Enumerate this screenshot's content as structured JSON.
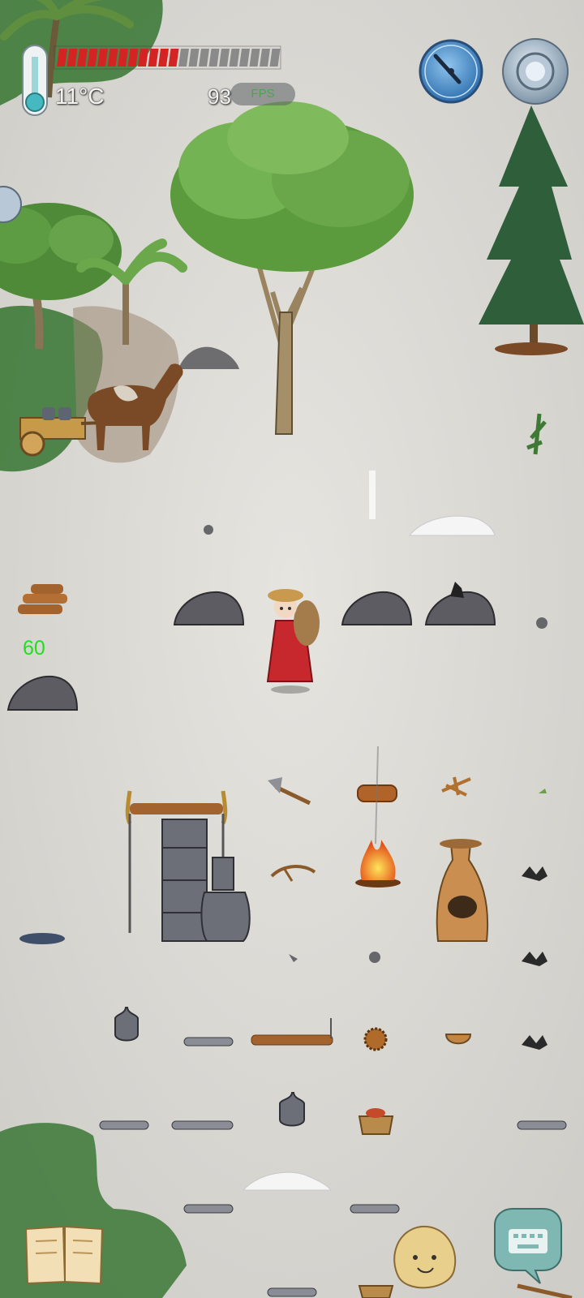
{
  "hud": {
    "temperature": "11°C",
    "health_fraction": 0.55,
    "health_segments_total": 22,
    "fps_value": "93",
    "fps_label": "FPS"
  },
  "world": {
    "floating_counter": "60"
  },
  "colors": {
    "health_red": "#d42323",
    "health_empty": "#8a8a8a",
    "paper_bg": "#dcdad5",
    "grass_green": "#3f7a3a",
    "dress_red": "#c6282d",
    "counter_green": "#22dd22"
  },
  "icons": {
    "thermometer": "thermometer-icon",
    "compass": "compass-icon",
    "settings": "gear-icon",
    "journal": "book-icon",
    "emote": "potato-face-icon",
    "chat": "keyboard-speech-icon"
  }
}
